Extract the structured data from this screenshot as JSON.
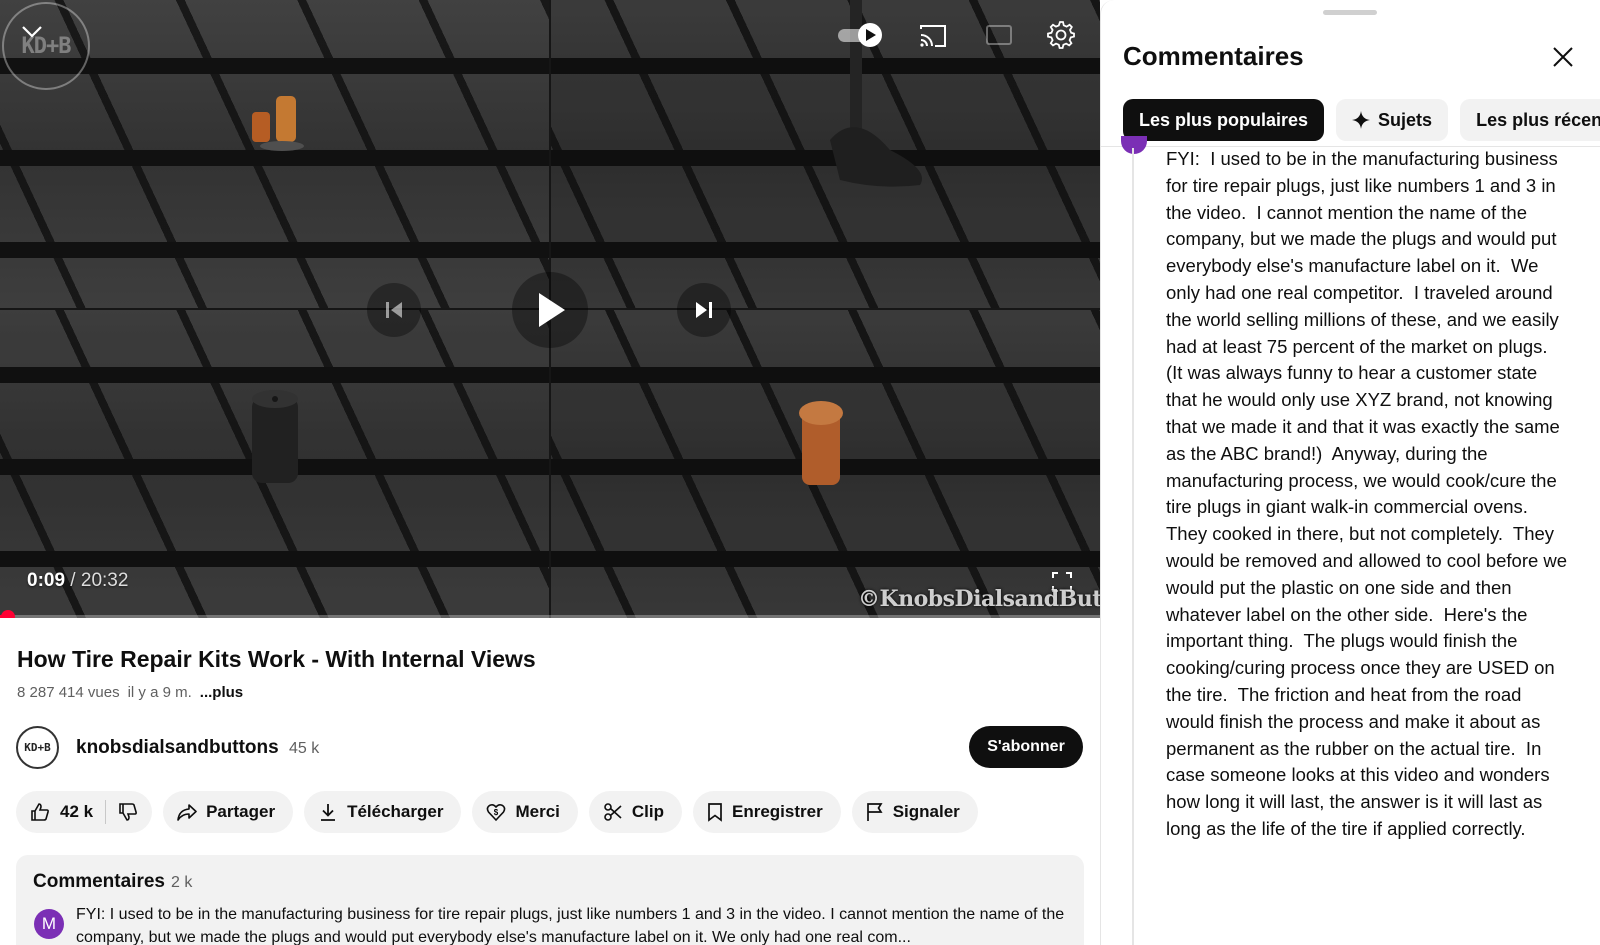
{
  "player": {
    "time_current": "0:09",
    "time_separator": " / ",
    "time_duration": "20:32",
    "watermark": "©KnobsDialsandButtons",
    "logo_text": "KD+B",
    "progress_fraction": 0.0073,
    "autoplay_on": true
  },
  "video": {
    "title": "How Tire Repair Kits Work - With Internal Views",
    "views": "8 287 414 vues",
    "age": "il y a 9 m.",
    "more": "...plus"
  },
  "channel": {
    "avatar_text": "KD+B",
    "name": "knobsdialsandbuttons",
    "subscribers": "45 k",
    "subscribe_label": "S'abonner"
  },
  "actions": {
    "likes": "42 k",
    "share": "Partager",
    "download": "Télécharger",
    "thanks": "Merci",
    "clip": "Clip",
    "save": "Enregistrer",
    "report": "Signaler"
  },
  "comments_card": {
    "title": "Commentaires",
    "count": "2 k",
    "avatar_letter": "M",
    "preview": "FYI:  I used to be in the manufacturing business for tire repair plugs, just like numbers 1 and 3 in the video.  I cannot mention the name of the company, but we made the plugs and would put everybody else's manufacture label on it.  We only had one real com..."
  },
  "panel": {
    "title": "Commentaires",
    "chips": [
      "Les plus populaires",
      "Sujets",
      "Les plus récen"
    ],
    "comment": "FYI:  I used to be in the manufacturing business for tire repair plugs, just like numbers 1 and 3 in the video.  I cannot mention the name of the company, but we made the plugs and would put everybody else's manufacture label on it.  We only had one real competitor.  I traveled around the world selling millions of these, and we easily had at least 75 percent of the market on plugs.  (It was always funny to hear a customer state that he would only use XYZ brand, not knowing that we made it and that it was exactly the same as the ABC brand!)  Anyway, during the manufacturing process, we would cook/cure the tire plugs in giant walk-in commercial ovens.  They cooked in there, but not completely.  They would be removed and allowed to cool before we would put the plastic on one side and then whatever label on the other side.  Here's the important thing.  The plugs would finish the cooking/curing process once they are USED on the tire.  The friction and heat from the road would finish the process and make it about as permanent as the rubber on the actual tire.  In case someone looks at this video and wonders how long it will last, the answer is it will last as long as the life of the tire if applied correctly."
  },
  "colors": {
    "accent_red": "#ff0033",
    "avatar_purple": "#7b2fb5",
    "chip_bg": "#f2f2f2",
    "dark": "#0f0f0f"
  },
  "icons": {
    "player": [
      "chevron-down-icon",
      "autoplay-toggle-icon",
      "cast-icon",
      "captions-icon",
      "gear-icon",
      "previous-icon",
      "play-icon",
      "next-icon",
      "fullscreen-icon"
    ],
    "actions": [
      "thumbs-up-icon",
      "thumbs-down-icon",
      "share-icon",
      "download-icon",
      "thanks-icon",
      "scissors-icon",
      "bookmark-icon",
      "flag-icon"
    ],
    "panel": [
      "close-icon",
      "sparkle-icon"
    ]
  }
}
